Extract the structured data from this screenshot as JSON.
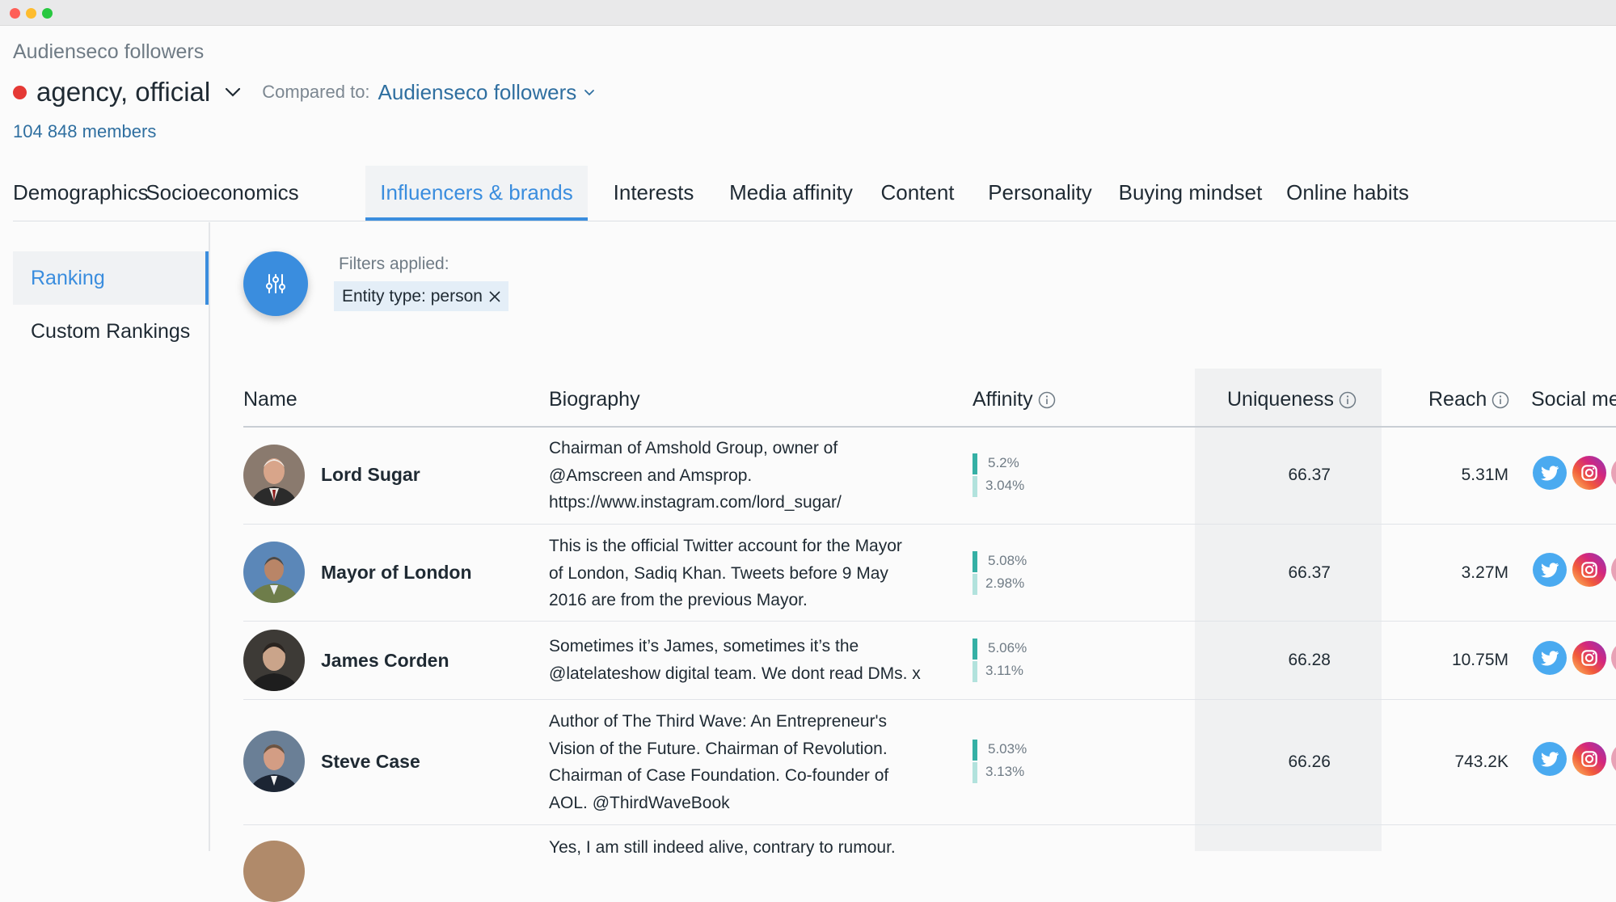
{
  "header": {
    "breadcrumb": "Audienseco followers",
    "segment_name": "agency, official",
    "segment_color": "#e53935",
    "compared_label": "Compared to:",
    "compared_value": "Audienseco followers",
    "members": "104 848 members"
  },
  "tabs": [
    {
      "label": "Demographics",
      "active": false
    },
    {
      "label": "Socioeconomics",
      "active": false
    },
    {
      "label": "Influencers & brands",
      "active": true
    },
    {
      "label": "Interests",
      "active": false
    },
    {
      "label": "Media affinity",
      "active": false
    },
    {
      "label": "Content",
      "active": false
    },
    {
      "label": "Personality",
      "active": false
    },
    {
      "label": "Buying mindset",
      "active": false
    },
    {
      "label": "Online habits",
      "active": false
    }
  ],
  "sidebar": {
    "items": [
      {
        "label": "Ranking",
        "active": true
      },
      {
        "label": "Custom Rankings",
        "active": false
      }
    ]
  },
  "filters": {
    "button_icon": "sliders-icon",
    "label": "Filters applied:",
    "chips": [
      {
        "label": "Entity type: person",
        "remove_icon": "close-icon"
      }
    ]
  },
  "table": {
    "columns": {
      "name": "Name",
      "biography": "Biography",
      "affinity": "Affinity",
      "uniqueness": "Uniqueness",
      "reach": "Reach",
      "social": "Social me"
    },
    "rows": [
      {
        "name": "Lord Sugar",
        "bio": [
          "Chairman of Amshold Group, owner of",
          "@Amscreen and Amsprop.",
          "https://www.instagram.com/lord_sugar/"
        ],
        "affinity_segment": "5.2%",
        "affinity_compared": "3.04%",
        "uniqueness": "66.37",
        "reach": "5.31M"
      },
      {
        "name": "Mayor of London",
        "bio": [
          "This is the official Twitter account for the Mayor",
          "of London, Sadiq Khan. Tweets before 9 May",
          "2016 are from the previous Mayor."
        ],
        "affinity_segment": "5.08%",
        "affinity_compared": "2.98%",
        "uniqueness": "66.37",
        "reach": "3.27M"
      },
      {
        "name": "James Corden",
        "bio": [
          "Sometimes it’s James, sometimes it’s the",
          "@latelateshow digital team. We dont read DMs. x"
        ],
        "affinity_segment": "5.06%",
        "affinity_compared": "3.11%",
        "uniqueness": "66.28",
        "reach": "10.75M"
      },
      {
        "name": "Steve Case",
        "bio": [
          "Author of The Third Wave: An Entrepreneur's",
          "Vision of the Future. Chairman of Revolution.",
          "Chairman of Case Foundation. Co-founder of",
          "AOL. @ThirdWaveBook"
        ],
        "affinity_segment": "5.03%",
        "affinity_compared": "3.13%",
        "uniqueness": "66.26",
        "reach": "743.2K"
      },
      {
        "name": "",
        "bio": [
          "Yes, I am still indeed alive, contrary to rumour."
        ],
        "affinity_segment": "",
        "affinity_compared": "",
        "uniqueness": "",
        "reach": ""
      }
    ]
  },
  "colors": {
    "accent": "#3a8dde",
    "affinity_segment": "#35b0a5",
    "affinity_compared": "#b2e2dd",
    "twitter": "#4aaaf0"
  }
}
